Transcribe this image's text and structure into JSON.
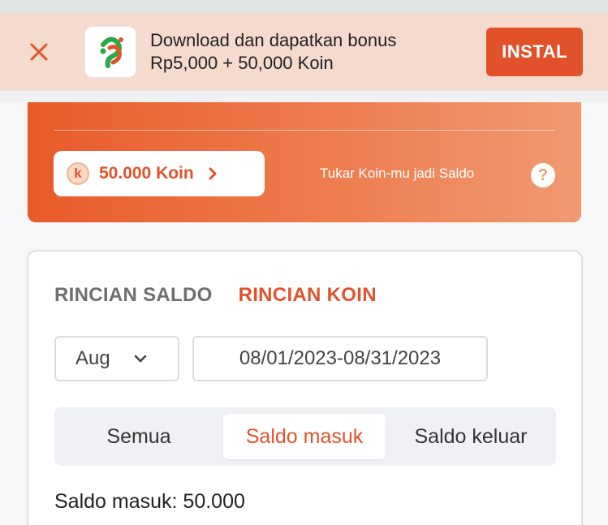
{
  "banner": {
    "close_icon": "close-icon",
    "app_icon": "app-logo",
    "text_line1": "Download dan dapatkan bonus",
    "text_line2": "Rp5,000 + 50,000 Koin",
    "install_label": "INSTAL",
    "colors": {
      "background": "#f5dace",
      "accent": "#e2522a"
    }
  },
  "koin_card": {
    "coin_icon_letter": "k",
    "balance_label": "50.000 Koin",
    "swap_text": "Tukar Koin-mu jadi Saldo",
    "help_label": "?",
    "colors": {
      "gradient_start": "#e95a2a",
      "gradient_end": "#f09a72"
    }
  },
  "detail": {
    "tabs": [
      {
        "label": "RINCIAN SALDO",
        "active": false
      },
      {
        "label": "RINCIAN KOIN",
        "active": true
      }
    ],
    "month_select": {
      "value": "Aug"
    },
    "date_range": "08/01/2023-08/31/2023",
    "filters": [
      {
        "label": "Semua",
        "selected": false
      },
      {
        "label": "Saldo masuk",
        "selected": true
      },
      {
        "label": "Saldo keluar",
        "selected": false
      }
    ],
    "summary": "Saldo masuk: 50.000"
  }
}
